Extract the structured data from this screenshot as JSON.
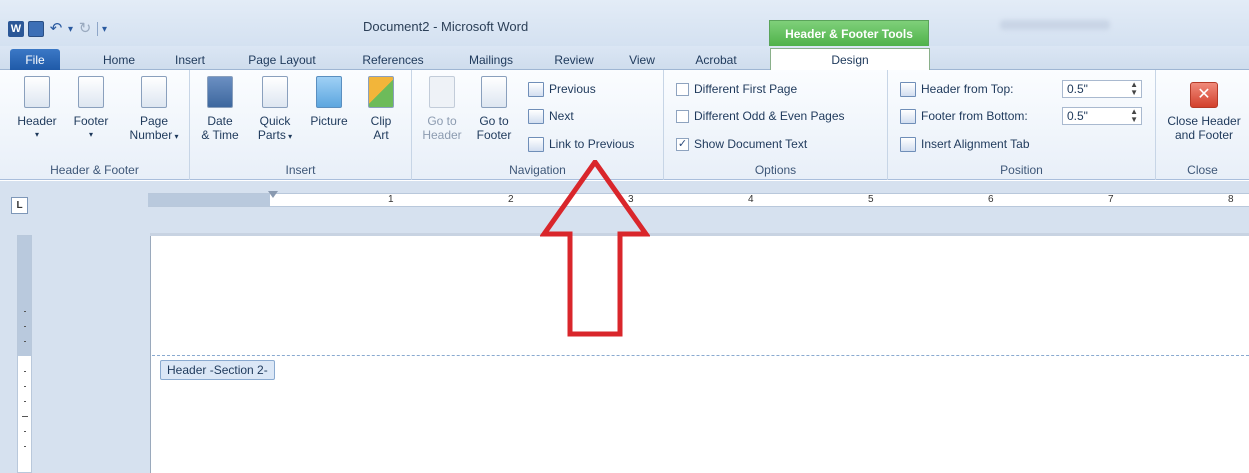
{
  "window": {
    "title": "Document2 - Microsoft Word",
    "contextual_tab_group": "Header & Footer Tools"
  },
  "tabs": [
    "File",
    "Home",
    "Insert",
    "Page Layout",
    "References",
    "Mailings",
    "Review",
    "View",
    "Acrobat",
    "Design"
  ],
  "groups": {
    "header_footer": {
      "label": "Header & Footer",
      "header": "Header",
      "footer": "Footer",
      "page_number_1": "Page",
      "page_number_2": "Number"
    },
    "insert": {
      "label": "Insert",
      "date_1": "Date",
      "date_2": "& Time",
      "quick_1": "Quick",
      "quick_2": "Parts",
      "picture": "Picture",
      "clip_1": "Clip",
      "clip_2": "Art"
    },
    "navigation": {
      "label": "Navigation",
      "goto_header_1": "Go to",
      "goto_header_2": "Header",
      "goto_footer_1": "Go to",
      "goto_footer_2": "Footer",
      "previous": "Previous",
      "next": "Next",
      "link_to_previous": "Link to Previous"
    },
    "options": {
      "label": "Options",
      "different_first_page": "Different First Page",
      "different_odd_even": "Different Odd & Even Pages",
      "show_document_text": "Show Document Text"
    },
    "position": {
      "label": "Position",
      "header_from_top": "Header from Top:",
      "header_from_top_value": "0.5\"",
      "footer_from_bottom": "Footer from Bottom:",
      "footer_from_bottom_value": "0.5\"",
      "insert_alignment_tab": "Insert Alignment Tab"
    },
    "close": {
      "label": "Close",
      "close_1": "Close Header",
      "close_2": "and Footer"
    }
  },
  "ruler": {
    "corner": "L",
    "numbers": [
      "1",
      "2",
      "3",
      "4",
      "5",
      "6",
      "7",
      "8"
    ]
  },
  "document": {
    "header_tag": "Header -Section 2-"
  },
  "colors": {
    "contextual_green": "#4fb24a",
    "annotation_arrow": "#d9262b",
    "file_tab": "#1f5aa8"
  }
}
